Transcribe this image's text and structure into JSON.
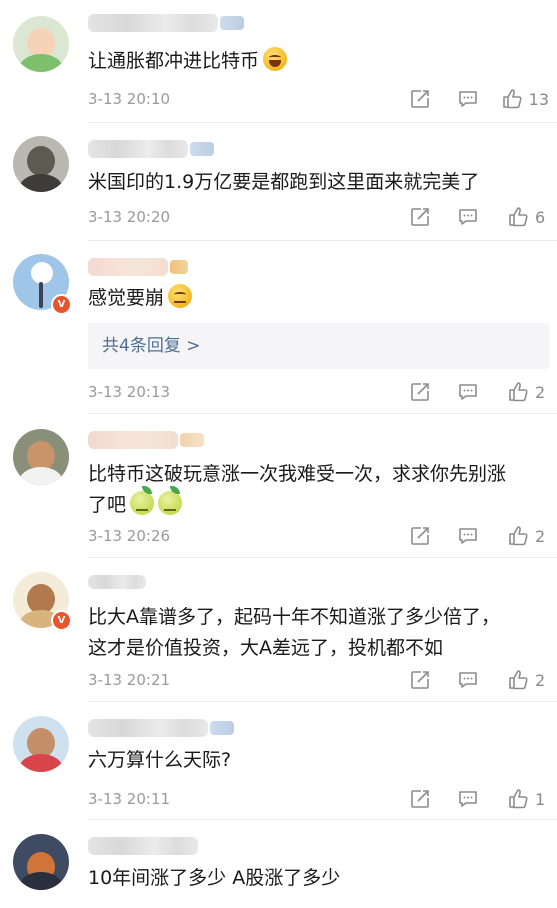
{
  "comments": [
    {
      "text": "让通胀都冲进比特币",
      "emoji": [
        "grin-emoji"
      ],
      "time": "3-13 20:10",
      "likes": "13"
    },
    {
      "text": "米国印的1.9万亿要是都跑到这里面来就完美了",
      "emoji": [],
      "time": "3-13 20:20",
      "likes": "6"
    },
    {
      "text": "感觉要崩",
      "emoji": [
        "smirk-emoji"
      ],
      "replies_label": "共4条回复 >",
      "time": "3-13 20:13",
      "likes": "2"
    },
    {
      "text_line1": "比特币这破玩意涨一次我难受一次，求求你先别涨",
      "text_line2": "了吧",
      "emoji": [
        "sick-emoji",
        "sick-emoji"
      ],
      "time": "3-13 20:26",
      "likes": "2"
    },
    {
      "text_line1": "比大A靠谱多了，起码十年不知道涨了多少倍了，",
      "text_line2": "这才是价值投资，大A差远了，投机都不如",
      "time": "3-13 20:21",
      "likes": "2"
    },
    {
      "text": "六万算什么天际?",
      "time": "3-13 20:11",
      "likes": "1"
    },
    {
      "text": "10年间涨了多少 A股涨了多少"
    }
  ],
  "colors": {
    "link": "#4e6e97",
    "meta": "#9a9a9a",
    "divider": "#ececec",
    "badge": "#e8542b"
  },
  "icons": [
    "share-icon",
    "comment-icon",
    "thumb-up-icon"
  ]
}
